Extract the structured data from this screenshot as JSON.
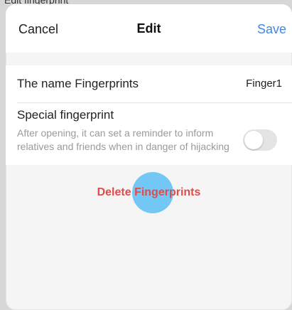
{
  "status": {
    "partial_text": "Edit fingerprint"
  },
  "header": {
    "cancel_label": "Cancel",
    "title": "Edit",
    "save_label": "Save"
  },
  "name_row": {
    "label": "The name Fingerprints",
    "value": "Finger1"
  },
  "special": {
    "title": "Special fingerprint",
    "description": "After opening, it can set a reminder to inform relatives and friends when in danger of hijacking",
    "toggle_on": false
  },
  "delete_label": "Delete Fingerprints",
  "colors": {
    "accent": "#3f86e8",
    "danger": "#e04b4b",
    "touch_indicator": "#5abef5"
  }
}
